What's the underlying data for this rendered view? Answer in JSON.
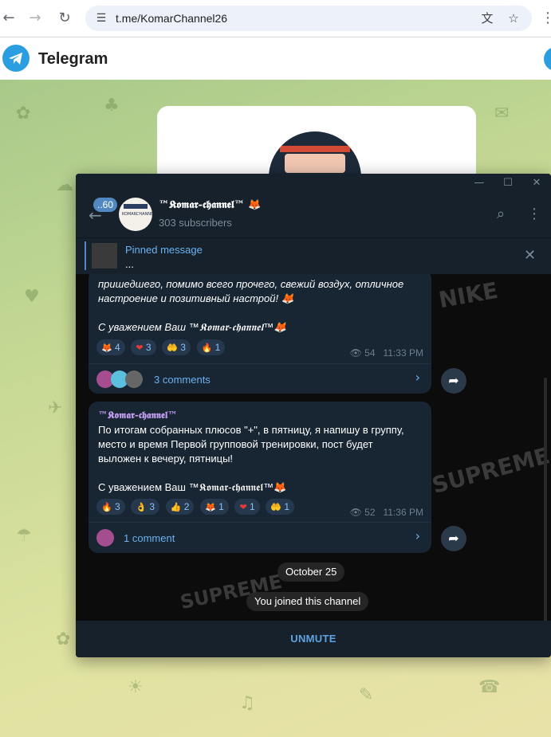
{
  "browser": {
    "url": "t.me/KomarChannel26",
    "back_icon": "←",
    "forward_icon": "→",
    "reload_icon": "↻",
    "tune_icon": "☰",
    "translate_icon": "文",
    "star_icon": "☆",
    "menu_icon": "⋮"
  },
  "telegram_page": {
    "title": "Telegram"
  },
  "window": {
    "minimize": "—",
    "maximize": "☐",
    "close": "✕"
  },
  "channel": {
    "unread": "..60",
    "title": "™𝕶𝖔𝖒𝖆𝖗-𝖈𝖍𝖆𝖓𝖓𝖊𝖑™ 🦊",
    "subscribers": "303 subscribers",
    "avatar_text": "KOMARCHANNEL",
    "search_icon": "⌕",
    "more_icon": "⋮"
  },
  "pinned": {
    "title": "Pinned message",
    "text": "...",
    "close_icon": "✕"
  },
  "messages": [
    {
      "text": "пришедшего, помимо всего прочего, свежий воздух, отличное\nнастроение и позитивный настрой! 🦊\n\nС уважением Ваш ™𝕶𝖔𝖒𝖆𝖗-𝖈𝖍𝖆𝖓𝖓𝖊𝖑™🦊",
      "reactions": [
        {
          "emoji": "🦊",
          "count": "4"
        },
        {
          "emoji": "❤",
          "count": "3"
        },
        {
          "emoji": "🤲",
          "count": "3"
        },
        {
          "emoji": "🔥",
          "count": "1"
        }
      ],
      "views": "54",
      "time": "11:33 PM",
      "comments": "3 comments"
    },
    {
      "author": "™𝕶𝖔𝖒𝖆𝖗-𝖈𝖍𝖆𝖓𝖓𝖊𝖑™",
      "text": "По итогам собранных плюсов \"+\", в пятницу, я напишу в группу,\nместо и время Первой групповой тренировки, пост будет\nвыложен к вечеру, пятницы!\n\nС уважением Ваш ™𝕶𝖔𝖒𝖆𝖗-𝖈𝖍𝖆𝖓𝖓𝖊𝖑™🦊",
      "reactions": [
        {
          "emoji": "🔥",
          "count": "3"
        },
        {
          "emoji": "👌",
          "count": "3"
        },
        {
          "emoji": "👍",
          "count": "2"
        },
        {
          "emoji": "🦊",
          "count": "1"
        },
        {
          "emoji": "❤",
          "count": "1"
        },
        {
          "emoji": "🤲",
          "count": "1"
        }
      ],
      "views": "52",
      "time": "11:36 PM",
      "comments": "1 comment"
    }
  ],
  "service": {
    "date": "October 25",
    "joined": "You joined this channel"
  },
  "bottom": {
    "unmute": "UNMUTE"
  },
  "decor": {
    "supreme_1": "SUPREME",
    "supreme_2": "SUPREME",
    "nike": "NIKE"
  },
  "icons": {
    "eye": "👁",
    "share": "➦",
    "chevron": "›",
    "back_arrow": "←"
  }
}
